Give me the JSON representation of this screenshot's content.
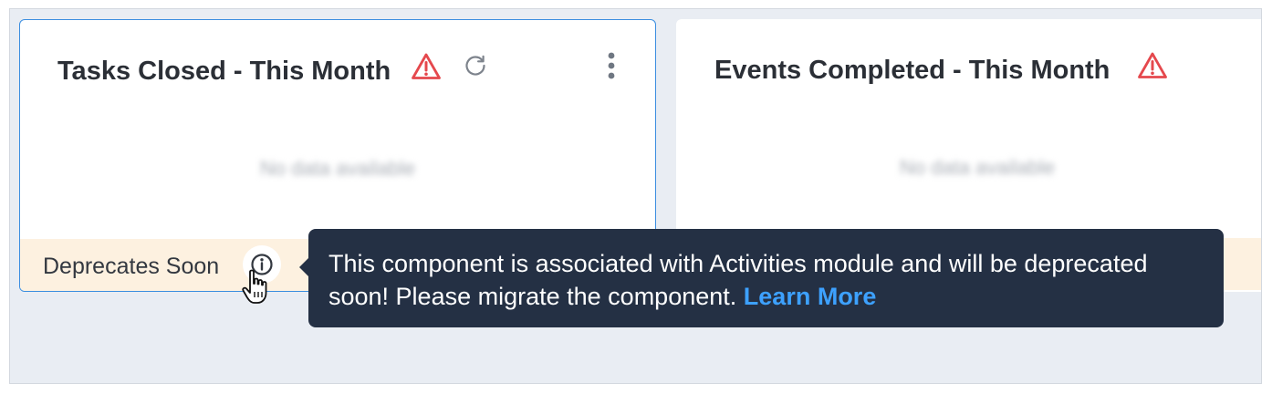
{
  "cards": [
    {
      "title": "Tasks Closed - This Month",
      "no_data": "No data available",
      "icons": [
        "warning-icon",
        "refresh-icon",
        "more-vertical-icon"
      ]
    },
    {
      "title": "Events Completed - This Month",
      "no_data": "No data available",
      "icons": [
        "warning-icon"
      ]
    }
  ],
  "deprecation": {
    "label": "Deprecates Soon",
    "icon": "info-icon"
  },
  "tooltip": {
    "message": "This component is associated with Activities module and will be deprecated soon! Please migrate the component.",
    "link_label": "Learn More"
  },
  "colors": {
    "warning": "#e5484d",
    "tooltip_bg": "#243044",
    "link": "#3da1ff",
    "selected_border": "#3b8ee0",
    "deprecate_bg": "#fdf1e0",
    "canvas_bg": "#e9edf3"
  }
}
